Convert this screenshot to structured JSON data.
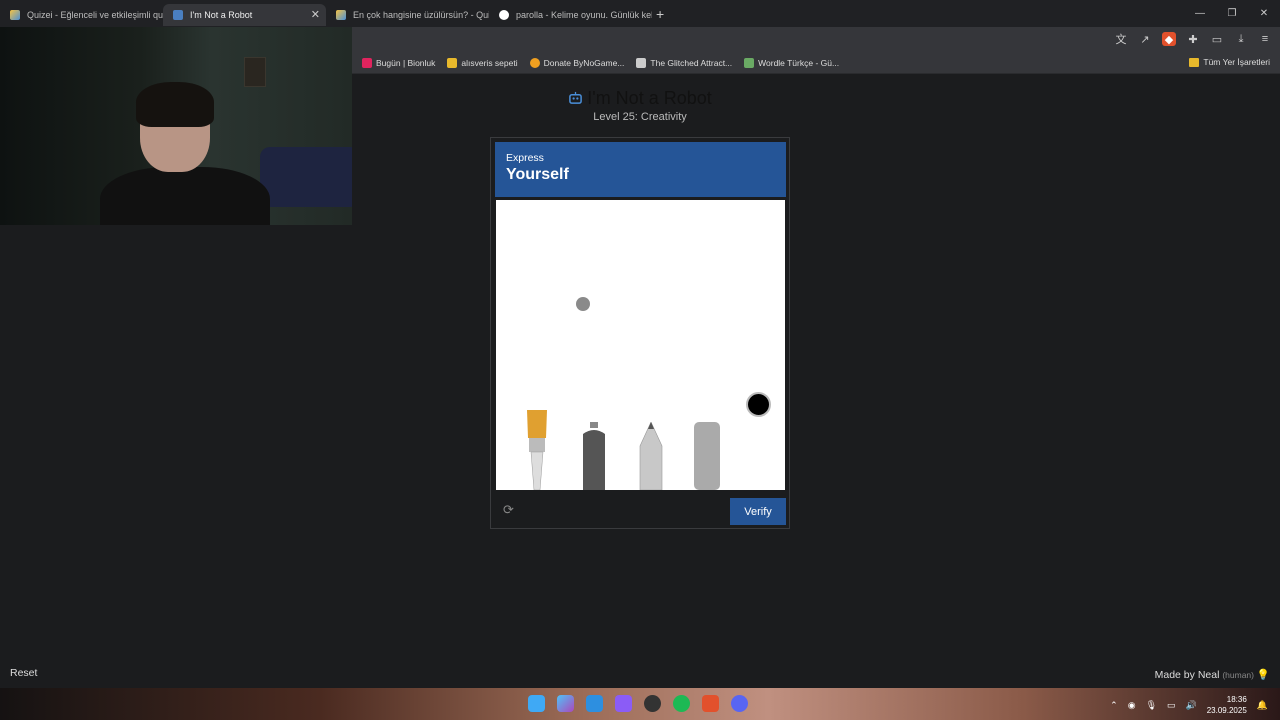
{
  "tabs": [
    {
      "label": "Quizei - Eğlenceli ve etkileşimli quizle",
      "icon": "quizei-icon",
      "active": false
    },
    {
      "label": "I'm Not a Robot",
      "icon": "robot-icon",
      "active": true,
      "close": "✕"
    },
    {
      "label": "En çok hangisine üzülürsün? - Quizei",
      "icon": "quizei-icon",
      "active": false
    },
    {
      "label": "parolla - Kelime oyunu. Günlük kelime",
      "icon": "parolla-icon",
      "active": false
    }
  ],
  "new_tab": "+",
  "window_controls": {
    "minimize": "—",
    "restore": "❐",
    "close": "✕"
  },
  "toolbar_icons": [
    "translate-icon",
    "share-icon",
    "brave-shield-icon",
    "extensions-icon",
    "sidebar-icon",
    "download-icon",
    "menu-icon"
  ],
  "bookmarks": [
    {
      "label": "Bugün | Bionluk",
      "color": "#e0245e"
    },
    {
      "label": "alısveris sepeti",
      "color": "#e8b92c"
    },
    {
      "label": "Donate ByNoGame...",
      "color": "#f0a020"
    },
    {
      "label": "The Glitched Attract...",
      "color": "#cccccc"
    },
    {
      "label": "Wordle Türkçe - Gü...",
      "color": "#6aaa64"
    }
  ],
  "bookmarks_right": "Tüm Yer İşaretleri",
  "page": {
    "title": "I'm Not a Robot",
    "level": "Level 25: Creativity"
  },
  "captcha": {
    "prompt_small": "Express",
    "prompt_big": "Yourself",
    "verify_label": "Verify",
    "tools": [
      "paintbrush",
      "spray-can",
      "pencil",
      "eraser"
    ],
    "current_color": "#000000"
  },
  "footer": {
    "reset": "Reset",
    "made_by": "Made by Neal",
    "human": "(human)"
  },
  "taskbar": {
    "time": "18:36",
    "date": "23.09.2025"
  },
  "colors": {
    "accent": "#255597",
    "page_bg": "#1b1c1e"
  }
}
